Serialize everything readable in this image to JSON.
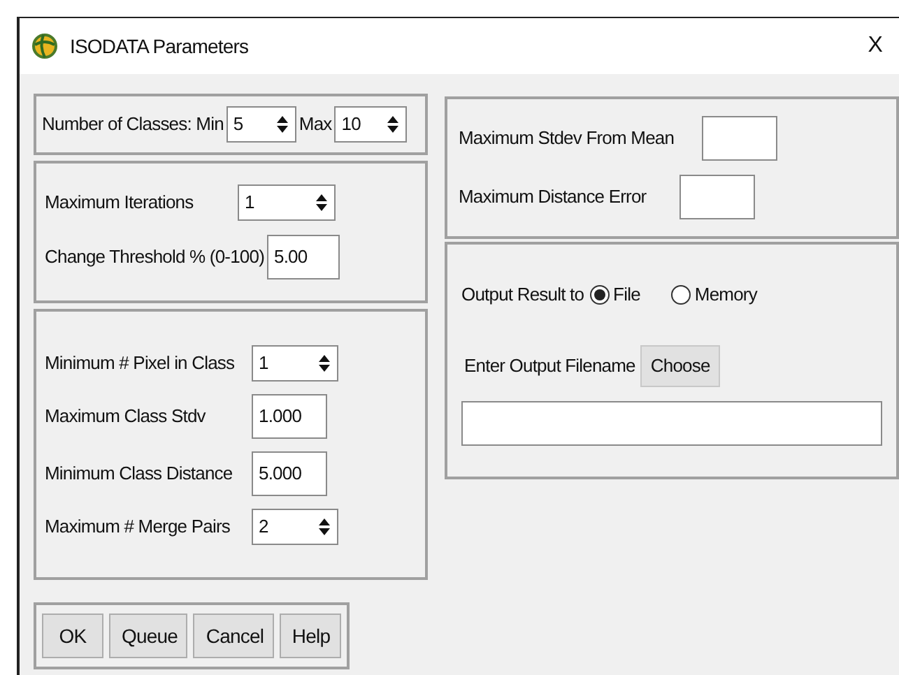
{
  "window": {
    "title": "ISODATA Parameters",
    "close": "X"
  },
  "classes": {
    "label": "Number of Classes: Min",
    "min": "5",
    "max_label": "Max",
    "max": "10"
  },
  "iterations_group": [
    {
      "kind": "spinner",
      "label": "Maximum Iterations",
      "value": "1"
    },
    {
      "kind": "text",
      "label": "Change Threshold % (0-100)",
      "value": "5.00"
    }
  ],
  "class_group": [
    {
      "kind": "spinner",
      "label": "Minimum # Pixel in Class",
      "value": "1"
    },
    {
      "kind": "text",
      "label": "Maximum Class Stdv",
      "value": "1.000"
    },
    {
      "kind": "text",
      "label": "Minimum Class Distance",
      "value": "5.000"
    },
    {
      "kind": "spinner",
      "label": "Maximum # Merge Pairs",
      "value": "2"
    }
  ],
  "buttons": [
    "OK",
    "Queue",
    "Cancel",
    "Help"
  ],
  "error_group": [
    {
      "kind": "text",
      "label": "Maximum Stdev From Mean"
    },
    {
      "kind": "text",
      "label": "Maximum Distance Error"
    }
  ],
  "output": {
    "label": "Output Result to",
    "options": [
      {
        "label": "File",
        "selected": true
      },
      {
        "label": "Memory",
        "selected": false
      }
    ],
    "filename_label": "Enter Output Filename",
    "choose": "Choose"
  }
}
